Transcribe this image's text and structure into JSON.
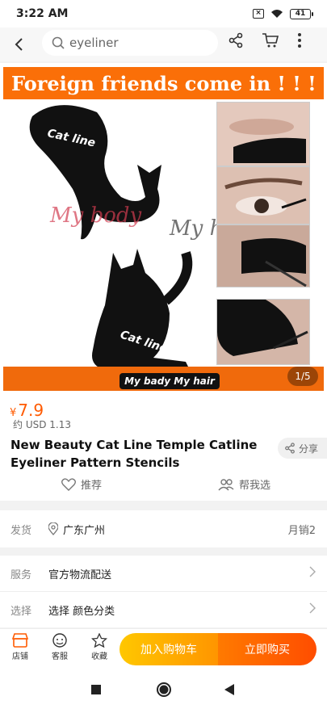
{
  "status": {
    "time": "3:22 AM",
    "battery": "41"
  },
  "header": {
    "search_text": "eyeliner"
  },
  "image": {
    "banner": "Foreign friends come in ! ! !",
    "watermark_1": "My body",
    "watermark_2": "My hair",
    "stencil_text": "Cat line",
    "brand_tag": "My bady My hair",
    "pager": "1/5"
  },
  "product": {
    "currency": "¥",
    "price": "7.9",
    "price_approx": "约 USD 1.13",
    "title": "New Beauty Cat Line Temple Catline Eyeliner Pattern Stencils",
    "share_label": "分享",
    "recommend_label": "推荐",
    "help_choose_label": "帮我选"
  },
  "shipping": {
    "label": "发货",
    "location": "广东广州",
    "monthly_sales": "月销2"
  },
  "service": {
    "label": "服务",
    "value": "官方物流配送"
  },
  "select": {
    "label": "选择",
    "value": "选择 颜色分类"
  },
  "action_bar": {
    "store": "店铺",
    "support": "客服",
    "favorite": "收藏",
    "add_to_cart": "加入购物车",
    "buy_now": "立即购买"
  },
  "colors": {
    "accent": "#ff5a00",
    "cart_gradient": [
      "#ffc700",
      "#ff9500"
    ],
    "buy_gradient": [
      "#ff7a00",
      "#ff4d00"
    ]
  }
}
